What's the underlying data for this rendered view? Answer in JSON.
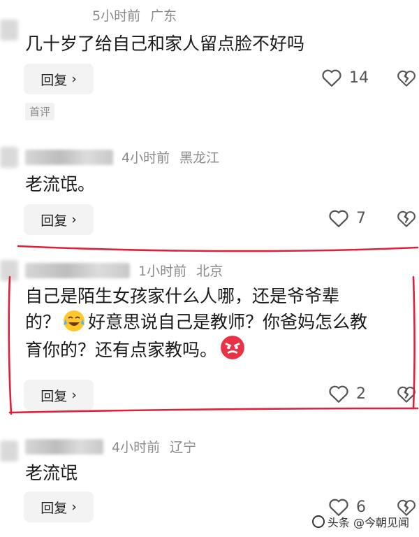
{
  "comments": [
    {
      "time": "5小时前",
      "location": "广东",
      "text": "几十岁了给自己和家人留点脸不好吗",
      "reply_label": "回复",
      "likes": "14",
      "badge": "首评"
    },
    {
      "time": "4小时前",
      "location": "黑龙江",
      "text": "老流氓。",
      "reply_label": "回复",
      "likes": "7"
    },
    {
      "time": "1小时前",
      "location": "北京",
      "text_line1": "自己是陌生女孩家什么人哪，还是爷爷辈",
      "text_line2_a": "的？",
      "text_line2_b": "好意思说自己是教师？你爸妈怎么教",
      "text_line3": "育你的？还有点家教吗。",
      "reply_label": "回复",
      "likes": "2"
    },
    {
      "time": "4小时前",
      "location": "辽宁",
      "text": "老流氓",
      "reply_label": "回复",
      "likes": "6"
    }
  ],
  "watermark": "头条 @今朝见闻",
  "colors": {
    "highlight": "#e0203a",
    "meta": "#8a8a8a",
    "reply_bg": "#f3f3f3"
  },
  "icons": [
    "heart-outline-icon",
    "broken-heart-icon",
    "chevron-right-icon",
    "laughing-crying-emoji",
    "angry-face-emoji"
  ]
}
